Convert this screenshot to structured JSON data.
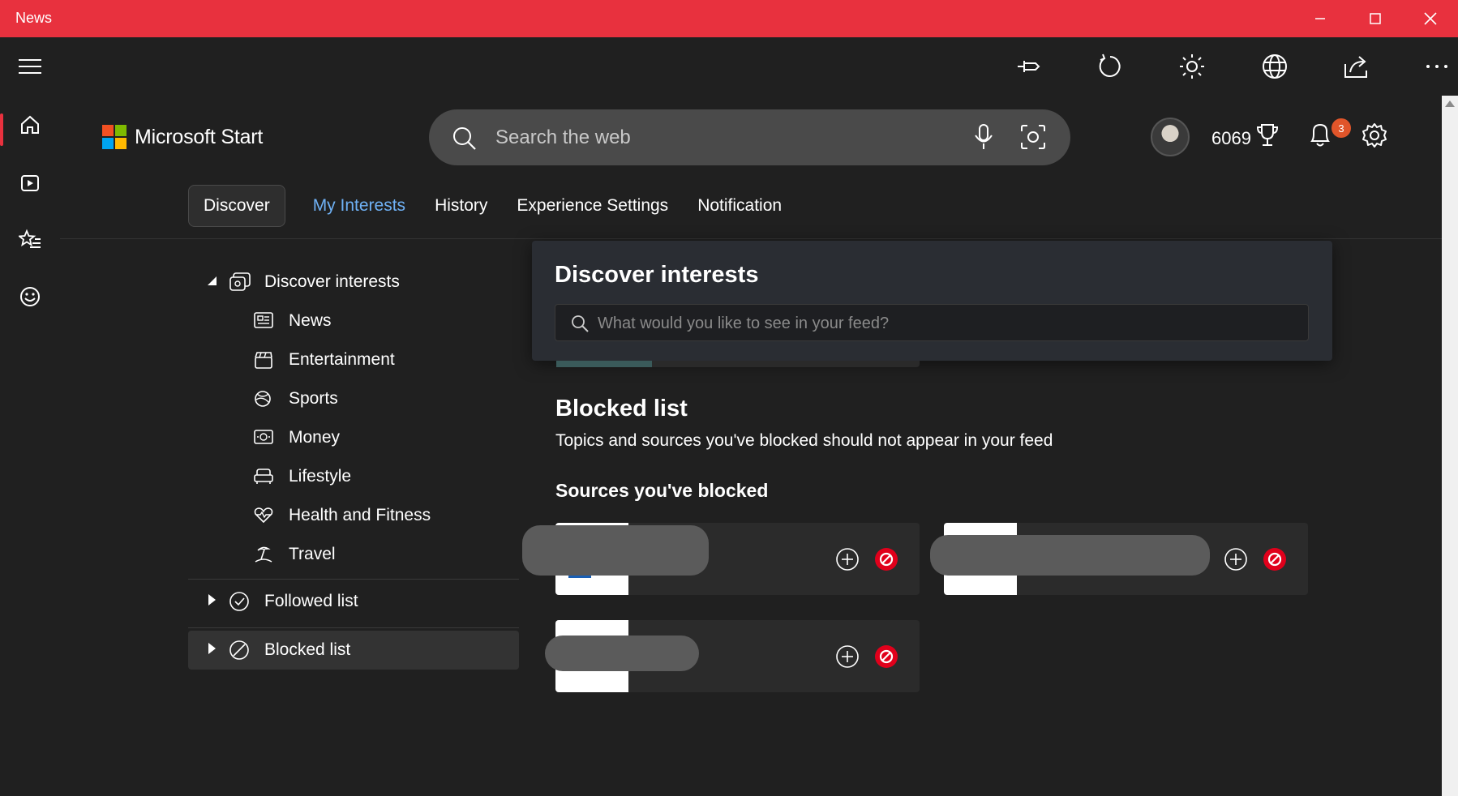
{
  "window": {
    "title": "News"
  },
  "toolbar": {
    "icons": [
      "menu-icon",
      "pin-icon",
      "refresh-icon",
      "brightness-icon",
      "globe-icon",
      "share-icon",
      "more-icon"
    ]
  },
  "rail": {
    "items": [
      "home-icon",
      "video-icon",
      "favorites-icon",
      "emoji-icon"
    ]
  },
  "header": {
    "brand": "Microsoft Start",
    "search_placeholder": "Search the web",
    "points": "6069",
    "notification_count": "3"
  },
  "tabs": [
    "Discover",
    "My Interests",
    "History",
    "Experience Settings",
    "Notification"
  ],
  "tree": {
    "discover": "Discover interests",
    "children": [
      "News",
      "Entertainment",
      "Sports",
      "Money",
      "Lifestyle",
      "Health and Fitness",
      "Travel"
    ],
    "followed": "Followed list",
    "blocked": "Blocked list"
  },
  "popup": {
    "title": "Discover interests",
    "placeholder": "What would you like to see in your feed?"
  },
  "blocked": {
    "title": "Blocked list",
    "description": "Topics and sources you've blocked should not appear in your feed",
    "sources_title": "Sources you've blocked"
  },
  "colors": {
    "accent": "#e8313e",
    "link": "#6fb1f5",
    "block": "#e0001b"
  }
}
